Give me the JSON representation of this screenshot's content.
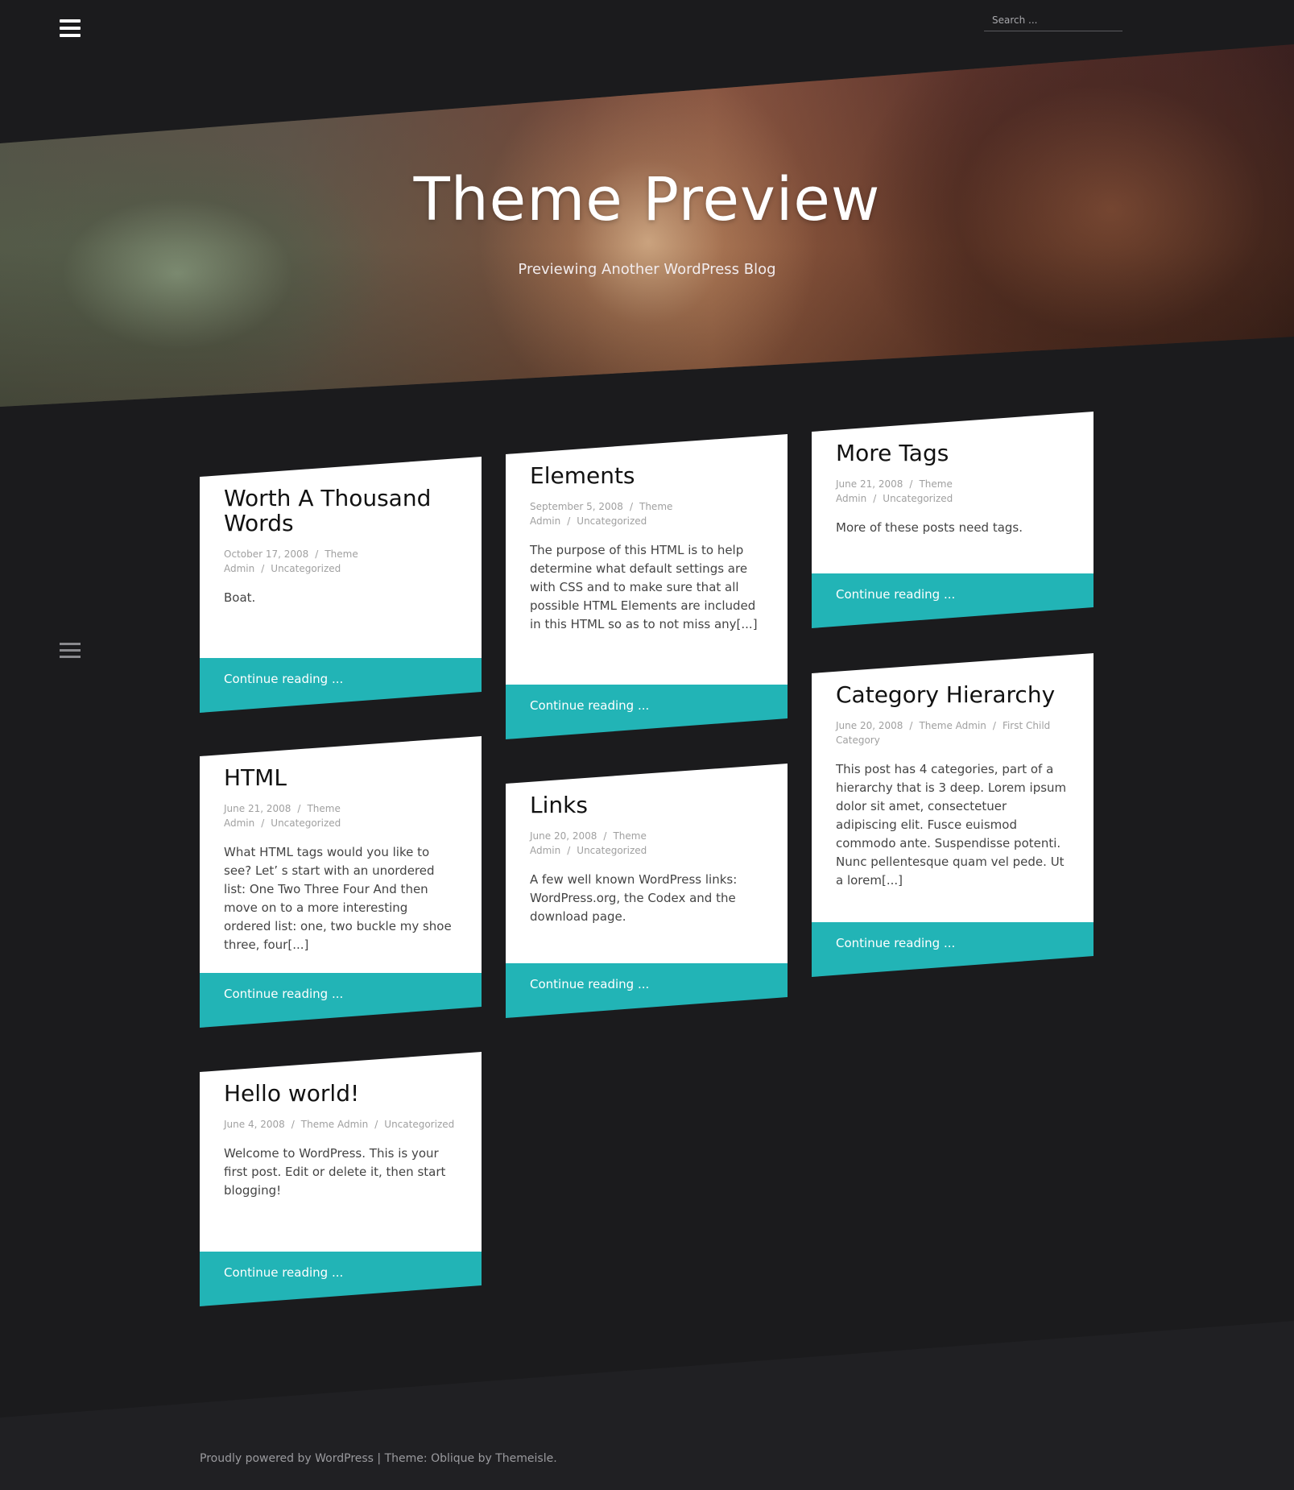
{
  "header": {
    "menu_icon": "hamburger-icon",
    "search_placeholder": "Search ..."
  },
  "hero": {
    "title": "Theme Preview",
    "tagline": "Previewing Another WordPress Blog"
  },
  "side_menu_icon": "hamburger-icon",
  "colors": {
    "background": "#1b1b1d",
    "accent": "#22b4b6",
    "card": "#ffffff"
  },
  "posts": [
    {
      "title": "Worth A Thousand Words",
      "date": "October 17, 2008",
      "author": "Theme Admin",
      "category": "Uncategorized",
      "excerpt": "Boat.",
      "cta": "Continue reading ..."
    },
    {
      "title": "Elements",
      "date": "September 5, 2008",
      "author": "Theme Admin",
      "category": "Uncategorized",
      "excerpt": "The purpose of this HTML is to help determine what default settings are with CSS and to make sure that all possible HTML Elements are included in this HTML so as to not miss any[...]",
      "cta": "Continue reading ..."
    },
    {
      "title": "More Tags",
      "date": "June 21, 2008",
      "author": "Theme Admin",
      "category": "Uncategorized",
      "excerpt": "More of these posts need tags.",
      "cta": "Continue reading ..."
    },
    {
      "title": "HTML",
      "date": "June 21, 2008",
      "author": "Theme Admin",
      "category": "Uncategorized",
      "excerpt": "What HTML tags would you like to see? Let’ s start with an unordered list: One Two Three Four And then move on to a more interesting ordered list: one, two buckle my shoe three, four[...]",
      "cta": "Continue reading ..."
    },
    {
      "title": "Links",
      "date": "June 20, 2008",
      "author": "Theme Admin",
      "category": "Uncategorized",
      "excerpt": "A few well known WordPress links: WordPress.org, the Codex and the download page.",
      "cta": "Continue reading ..."
    },
    {
      "title": "Category Hierarchy",
      "date": "June 20, 2008",
      "author": "Theme Admin",
      "category": "First Child Category",
      "excerpt": "This post has 4 categories, part of a hierarchy that is 3 deep. Lorem ipsum dolor sit amet, consectetuer adipiscing elit. Fusce euismod commodo ante. Suspendisse potenti. Nunc pellentesque quam vel pede. Ut a lorem[...]",
      "cta": "Continue reading ..."
    },
    {
      "title": "Hello world!",
      "date": "June 4, 2008",
      "author": "Theme Admin",
      "category": "Uncategorized",
      "excerpt": "Welcome to WordPress. This is your first post. Edit or delete it, then start blogging!",
      "cta": "Continue reading ..."
    }
  ],
  "footer": {
    "powered_prefix": "Proudly powered by ",
    "powered_link": "WordPress",
    "separator": " | ",
    "theme_prefix": "Theme: ",
    "theme_link": "Oblique",
    "by_text": " by ",
    "author_link": "Themeisle",
    "suffix": "."
  }
}
